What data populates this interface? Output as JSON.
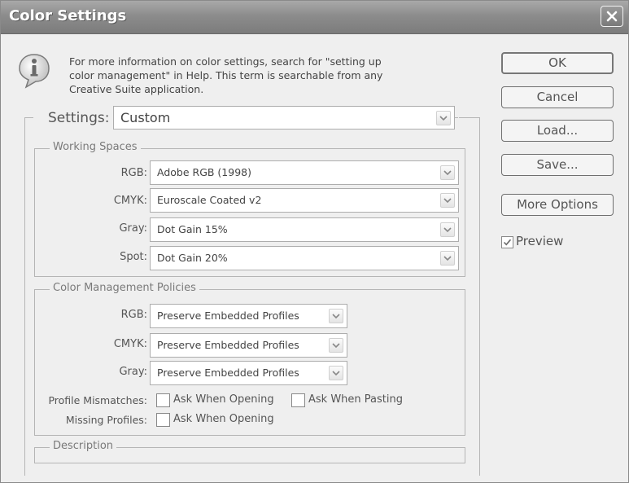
{
  "window": {
    "title": "Color Settings"
  },
  "info": {
    "icon": "info-icon",
    "lines": [
      "For more information on color settings, search for \"setting up",
      "color management\" in Help. This term is searchable from any",
      "Creative Suite application."
    ]
  },
  "buttons": {
    "ok": "OK",
    "cancel": "Cancel",
    "load": "Load...",
    "save": "Save...",
    "more_options": "More Options"
  },
  "preview": {
    "label": "Preview",
    "checked": true
  },
  "settings": {
    "label": "Settings:",
    "value": "Custom"
  },
  "working_spaces": {
    "legend": "Working Spaces",
    "rows": [
      {
        "label": "RGB:",
        "value": "Adobe RGB (1998)"
      },
      {
        "label": "CMYK:",
        "value": "Euroscale Coated v2"
      },
      {
        "label": "Gray:",
        "value": "Dot Gain 15%"
      },
      {
        "label": "Spot:",
        "value": "Dot Gain 20%"
      }
    ]
  },
  "policies": {
    "legend": "Color Management Policies",
    "rows": [
      {
        "label": "RGB:",
        "value": "Preserve Embedded Profiles"
      },
      {
        "label": "CMYK:",
        "value": "Preserve Embedded Profiles"
      },
      {
        "label": "Gray:",
        "value": "Preserve Embedded Profiles"
      }
    ],
    "profile_mismatches": {
      "label": "Profile Mismatches:",
      "ask_opening": "Ask When Opening",
      "ask_pasting": "Ask When Pasting"
    },
    "missing_profiles": {
      "label": "Missing Profiles:",
      "ask_opening": "Ask When Opening"
    }
  },
  "description": {
    "legend": "Description"
  }
}
